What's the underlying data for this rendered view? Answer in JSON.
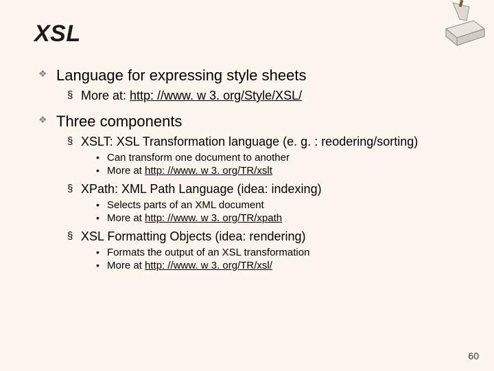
{
  "title": "XSL",
  "page_number": "60",
  "bullets": [
    {
      "text": "Language for expressing style sheets",
      "sub": [
        {
          "prefix": "More at: ",
          "link": "http: //www. w 3. org/Style/XSL/"
        }
      ]
    },
    {
      "text": "Three components",
      "sub": [
        {
          "text": "XSLT: XSL Transformation language  (e. g. : reodering/sorting)",
          "detail": [
            {
              "text": "Can transform one document to another"
            },
            {
              "prefix": "More at ",
              "link": "http: //www. w 3. org/TR/xslt"
            }
          ]
        },
        {
          "text": "XPath: XML Path Language (idea:  indexing)",
          "detail": [
            {
              "text": "Selects parts of an XML document"
            },
            {
              "prefix": "More at ",
              "link": "http: //www. w 3. org/TR/xpath"
            }
          ]
        },
        {
          "text": "XSL Formatting Objects  (idea:  rendering)",
          "detail": [
            {
              "text": "Formats the output of an XSL transformation"
            },
            {
              "prefix": "More at ",
              "link": "http: //www. w 3. org/TR/xsl/"
            }
          ]
        }
      ]
    }
  ]
}
